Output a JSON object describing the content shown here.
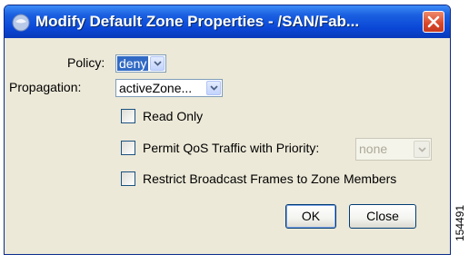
{
  "window": {
    "title": "Modify Default Zone Properties - /SAN/Fab...",
    "title_icon": "java-app-icon",
    "close_icon": "close-x-icon"
  },
  "form": {
    "policy": {
      "label": "Policy:",
      "value": "deny"
    },
    "propagation": {
      "label": "Propagation:",
      "value": "activeZone..."
    },
    "read_only": {
      "label": "Read Only",
      "checked": false
    },
    "permit_qos": {
      "label": "Permit QoS Traffic with Priority:",
      "checked": false,
      "priority_value": "none",
      "priority_enabled": false
    },
    "restrict_broadcast": {
      "label": "Restrict Broadcast Frames to Zone Members",
      "checked": false
    }
  },
  "buttons": {
    "ok_label": "OK",
    "close_label": "Close"
  },
  "figure_id": "154491",
  "colors": {
    "titlebar": "#0a47d6",
    "close_button": "#d9462a",
    "dialog_background": "#ece9d8",
    "selection": "#316ac5"
  }
}
